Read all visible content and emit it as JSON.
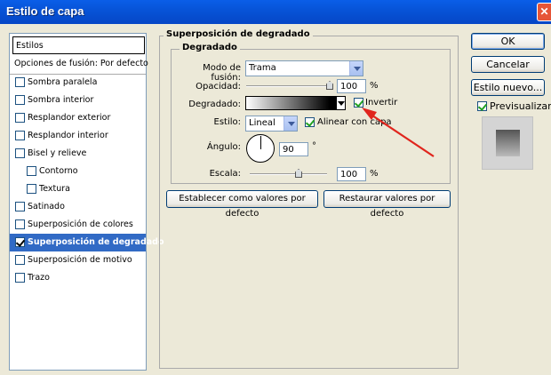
{
  "window": {
    "title": "Estilo de capa"
  },
  "styles_list": {
    "header": "Estilos",
    "blend_options": "Opciones de fusión: Por defecto",
    "items": [
      {
        "label": "Sombra paralela",
        "checked": false
      },
      {
        "label": "Sombra interior",
        "checked": false
      },
      {
        "label": "Resplandor exterior",
        "checked": false
      },
      {
        "label": "Resplandor interior",
        "checked": false
      },
      {
        "label": "Bisel y relieve",
        "checked": false
      },
      {
        "label": "Contorno",
        "checked": false
      },
      {
        "label": "Textura",
        "checked": false
      },
      {
        "label": "Satinado",
        "checked": false
      },
      {
        "label": "Superposición de colores",
        "checked": false
      },
      {
        "label": "Superposición de degradado",
        "checked": true,
        "selected": true
      },
      {
        "label": "Superposición de motivo",
        "checked": false
      },
      {
        "label": "Trazo",
        "checked": false
      }
    ]
  },
  "panel": {
    "outer_title": "Superposición de degradado",
    "inner_title": "Degradado",
    "blend_mode_label": "Modo de fusión:",
    "blend_mode_value": "Trama",
    "opacity_label": "Opacidad:",
    "opacity_value": "100",
    "opacity_unit": "%",
    "gradient_label": "Degradado:",
    "invert_label": "Invertir",
    "invert_checked": true,
    "style_label": "Estilo:",
    "style_value": "Lineal",
    "align_label": "Alinear con capa",
    "align_checked": true,
    "angle_label": "Ángulo:",
    "angle_value": "90",
    "angle_unit": "°",
    "scale_label": "Escala:",
    "scale_value": "100",
    "scale_unit": "%",
    "default_button": "Establecer como valores por defecto",
    "restore_button": "Restaurar valores por defecto"
  },
  "actions": {
    "ok": "OK",
    "cancel": "Cancelar",
    "new_style": "Estilo nuevo...",
    "preview_label": "Previsualizar",
    "preview_checked": true
  },
  "icons": {
    "close": "close-icon",
    "dropdown": "chevron-down-icon",
    "arrow": "red-arrow-annotation"
  },
  "colors": {
    "titlebar": "#0554d6",
    "selection": "#316ac5",
    "annotation": "#e0251d"
  }
}
